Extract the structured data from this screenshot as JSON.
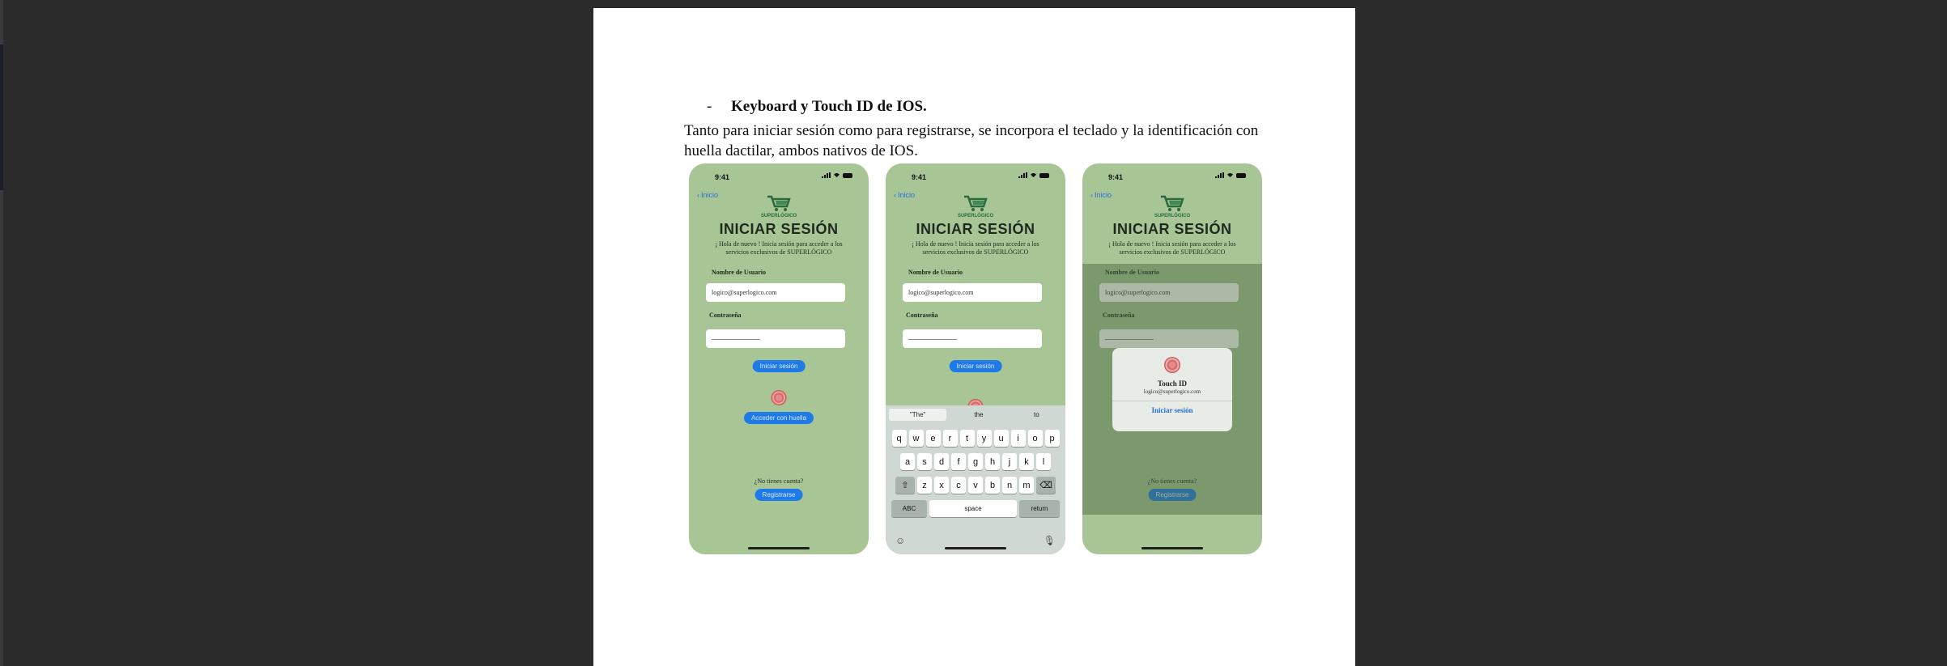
{
  "document": {
    "bullet": "-",
    "heading": "Keyboard y Touch ID de IOS.",
    "paragraph": "Tanto para iniciar sesión como para registrarse, se incorpora el teclado y la identificación con huella dactilar, ambos nativos de IOS."
  },
  "screen": {
    "time": "9:41",
    "back_label": "Inicio",
    "brand": "SUPERLÓGICO",
    "title": "INICIAR SESIÓN",
    "subtitle": "¡ Hola de nuevo ! Inicia sesión para acceder a los servicios exclusivos de SUPERLÓGICO",
    "user_label": "Nombre de Usuario",
    "user_value": "logico@superlogico.com",
    "password_label": "Contraseña",
    "login_button": "Iniciar sesión",
    "fingerprint_button": "Acceder con huella",
    "no_account": "¿No tienes cuenta?",
    "register_button": "Registrarse"
  },
  "keyboard": {
    "suggestions": [
      "\"The\"",
      "the",
      "to"
    ],
    "row1": [
      "q",
      "w",
      "e",
      "r",
      "t",
      "y",
      "u",
      "i",
      "o",
      "p"
    ],
    "row2": [
      "a",
      "s",
      "d",
      "f",
      "g",
      "h",
      "j",
      "k",
      "l"
    ],
    "row3": [
      "z",
      "x",
      "c",
      "v",
      "b",
      "n",
      "m"
    ],
    "abc": "ABC",
    "space": "space",
    "return": "return"
  },
  "touch_id": {
    "title": "Touch ID",
    "account": "logico@superlogico.com",
    "action": "Iniciar sesión"
  }
}
